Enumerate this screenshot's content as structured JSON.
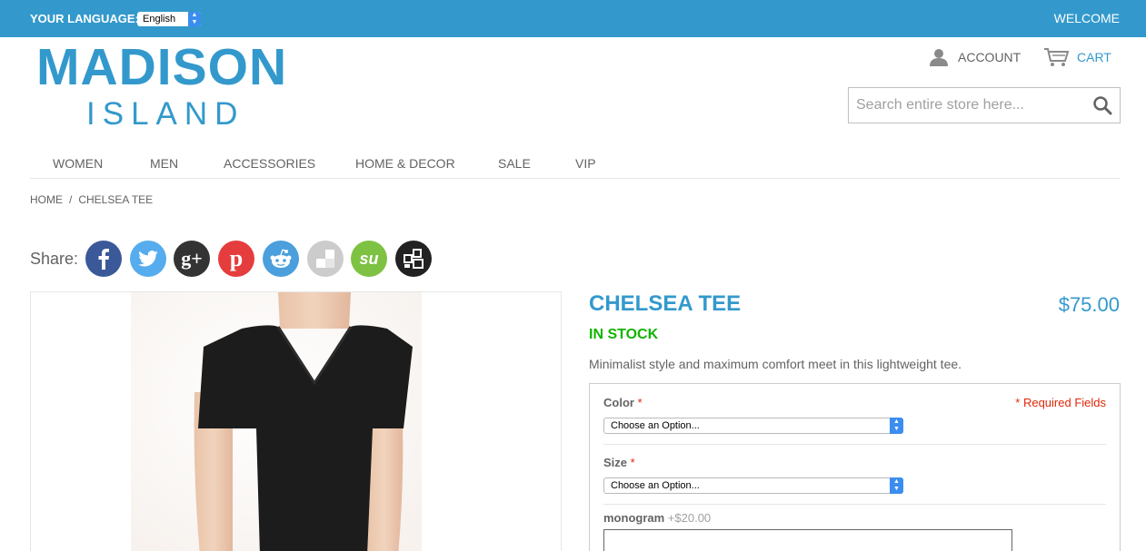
{
  "topbar": {
    "language_label": "YOUR LANGUAGE:",
    "language_value": "English",
    "welcome": "WELCOME",
    "color": "#3399cc"
  },
  "logo": {
    "line1": "MADISON",
    "line2": "ISLAND"
  },
  "header": {
    "account_label": "ACCOUNT",
    "cart_label": "CART",
    "search_placeholder": "Search entire store here..."
  },
  "nav": {
    "items": [
      {
        "label": "WOMEN"
      },
      {
        "label": "MEN"
      },
      {
        "label": "ACCESSORIES"
      },
      {
        "label": "HOME & DECOR"
      },
      {
        "label": "SALE"
      },
      {
        "label": "VIP"
      }
    ]
  },
  "breadcrumb": {
    "home": "HOME",
    "separator": "/",
    "current": "CHELSEA TEE"
  },
  "share": {
    "label": "Share:",
    "icons": [
      {
        "name": "facebook-icon",
        "color": "#3b5998"
      },
      {
        "name": "twitter-icon",
        "color": "#55acee"
      },
      {
        "name": "google-plus-icon",
        "color": "#333333"
      },
      {
        "name": "pinterest-icon",
        "color": "#e53d3d"
      },
      {
        "name": "reddit-icon",
        "color": "#4a9fdc"
      },
      {
        "name": "delicious-icon",
        "color": "#cccccc"
      },
      {
        "name": "stumbleupon-icon",
        "color": "#7ec244"
      },
      {
        "name": "share-more-icon",
        "color": "#222222"
      }
    ]
  },
  "product": {
    "name": "CHELSEA TEE",
    "price": "$75.00",
    "stock": "IN STOCK",
    "description": "Minimalist style and maximum comfort meet in this lightweight tee."
  },
  "options": {
    "required_note": "* Required Fields",
    "color": {
      "label": "Color",
      "required_mark": "*",
      "value": "Choose an Option..."
    },
    "size": {
      "label": "Size",
      "required_mark": "*",
      "value": "Choose an Option..."
    },
    "monogram": {
      "label": "monogram",
      "price": "+$20.00"
    }
  },
  "colors": {
    "accent": "#3399cc",
    "in_stock": "#11b400",
    "required": "#df280a"
  }
}
